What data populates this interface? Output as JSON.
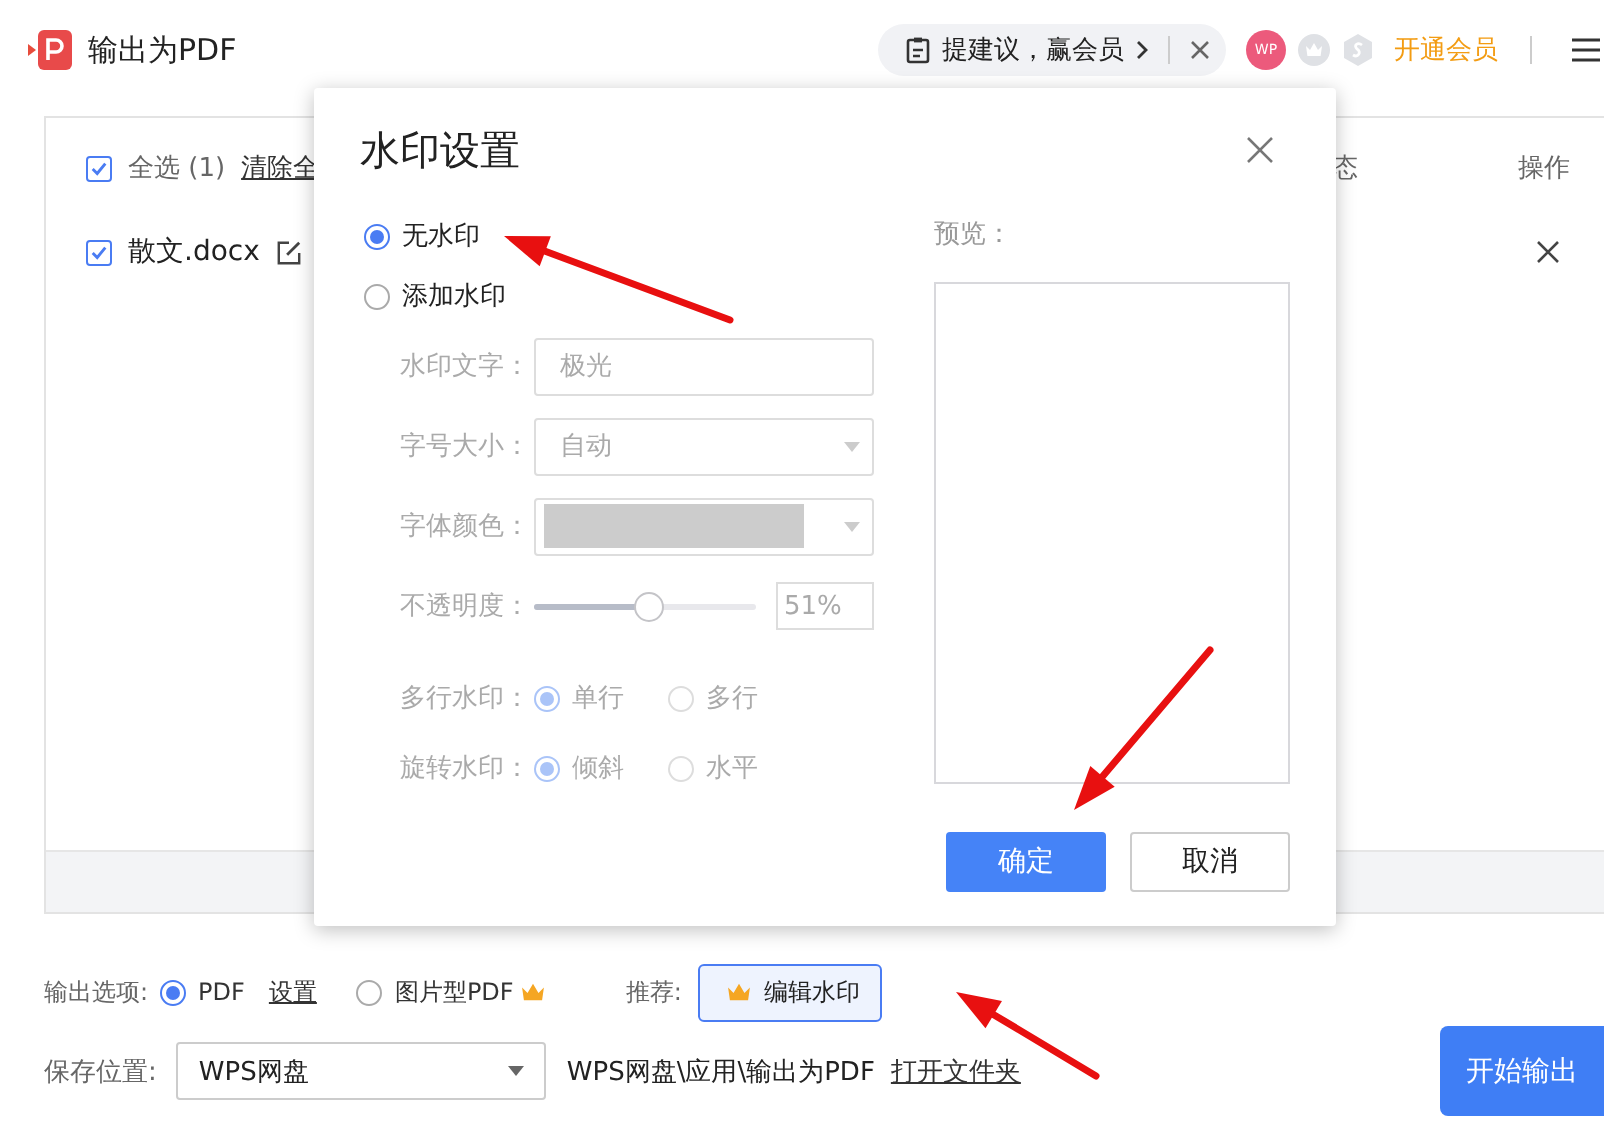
{
  "app": {
    "title": "输出为PDF"
  },
  "header": {
    "feedback": "提建议，赢会员",
    "avatar": "WP",
    "vip_link": "开通会员"
  },
  "file_list": {
    "select_all": {
      "label": "全选 (1)",
      "checked": true
    },
    "clear_link": "清除全",
    "columns": [
      "态",
      "操作"
    ],
    "files": [
      {
        "name": "散文.docx",
        "checked": true
      }
    ]
  },
  "output": {
    "label": "输出选项:",
    "options": [
      {
        "label": "PDF",
        "selected": true,
        "premium": false
      },
      {
        "label": "图片型PDF",
        "selected": false,
        "premium": true
      }
    ],
    "settings_link": "设置",
    "recommend_label": "推荐:",
    "edit_watermark_button": "编辑水印",
    "save_label": "保存位置:",
    "save_location": "WPS网盘",
    "save_path": "WPS网盘\\应用\\输出为PDF",
    "open_folder_link": "打开文件夹",
    "start_button": "开始输出"
  },
  "dialog": {
    "title": "水印设置",
    "modes": [
      {
        "label": "无水印",
        "selected": true
      },
      {
        "label": "添加水印",
        "selected": false
      }
    ],
    "settings_disabled": true,
    "text_label": "水印文字：",
    "text_value": "极光",
    "size_label": "字号大小：",
    "size_value": "自动",
    "color_label": "字体颜色：",
    "opacity_label": "不透明度：",
    "opacity": {
      "level": 0.51,
      "reading": "51%"
    },
    "multiline_label": "多行水印：",
    "multiline_options": [
      {
        "label": "单行",
        "selected": true
      },
      {
        "label": "多行",
        "selected": false
      }
    ],
    "rotate_label": "旋转水印：",
    "rotate_options": [
      {
        "label": "倾斜",
        "selected": true
      },
      {
        "label": "水平",
        "selected": false
      }
    ],
    "preview_label": "预览：",
    "buttons": [
      {
        "label": "确定",
        "kind": "primary"
      },
      {
        "label": "取消",
        "kind": "secondary"
      }
    ]
  }
}
